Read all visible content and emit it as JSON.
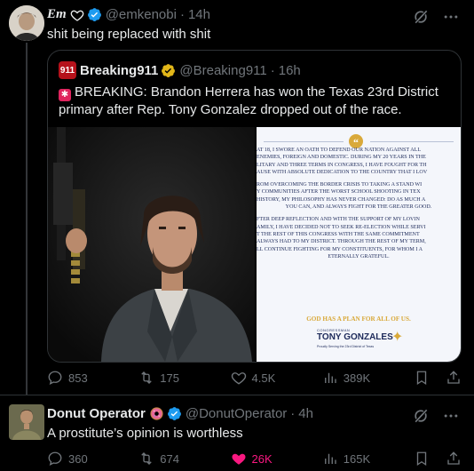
{
  "colors": {
    "bg": "#000000",
    "text": "#e7e9ea",
    "muted": "#71767b",
    "verified": "#1d9bf0",
    "like_active": "#f91880",
    "border": "#2f3336",
    "gold": "#d9a93a"
  },
  "tweet1": {
    "display_name": "Em",
    "heart_icon": "heart-outline-icon",
    "handle": "@emkenobi",
    "time": "14h",
    "text": "shit being replaced with shit",
    "quote": {
      "logo_text": "911",
      "display_name": "Breaking911",
      "handle": "@Breaking911",
      "time": "16h",
      "text": "BREAKING: Brandon Herrera has won the Texas 23rd District primary after Rep. Tony Gonzalez dropped out of the race.",
      "statement": {
        "para1": [
          "At 18, I swore an oath to defend our nation against all",
          "enemies, foreign and domestic. During my 20 years in the",
          "litary and three terms in Congress, I have fought for th",
          "ause with absolute dedication to the country that I lov"
        ],
        "para2": [
          "rom overcoming the border crisis to taking a stand wi",
          "y communities after the worst school shooting in Tex",
          "history, my philosophy has never changed: do as much a",
          "you can, and always fight for the greater good."
        ],
        "para3": [
          "fter deep reflection and with the support of my lovin",
          "amily, I have decided not to seek re-election while servi",
          "t the rest of this Congress with the same commitment",
          "always had to my district. Through the rest of my term,",
          "ll continue fighting for my constituents, for whom I a",
          "eternally grateful."
        ],
        "closing": "God has a plan for all of us.",
        "sig_top": "CONGRESSMAN",
        "signature": "TONY GONZALES",
        "sig_sub": "Proudly Serving the 23rd District of Texas"
      }
    },
    "stats": {
      "replies": "853",
      "reposts": "175",
      "likes": "4.5K",
      "views": "389K"
    }
  },
  "tweet2": {
    "display_name": "Donut Operator",
    "emoji_icon": "donut-emoji-icon",
    "handle": "@DonutOperator",
    "time": "4h",
    "text": "A prostitute’s opinion is worthless",
    "stats": {
      "replies": "360",
      "reposts": "674",
      "likes": "26K",
      "views": "165K"
    }
  }
}
